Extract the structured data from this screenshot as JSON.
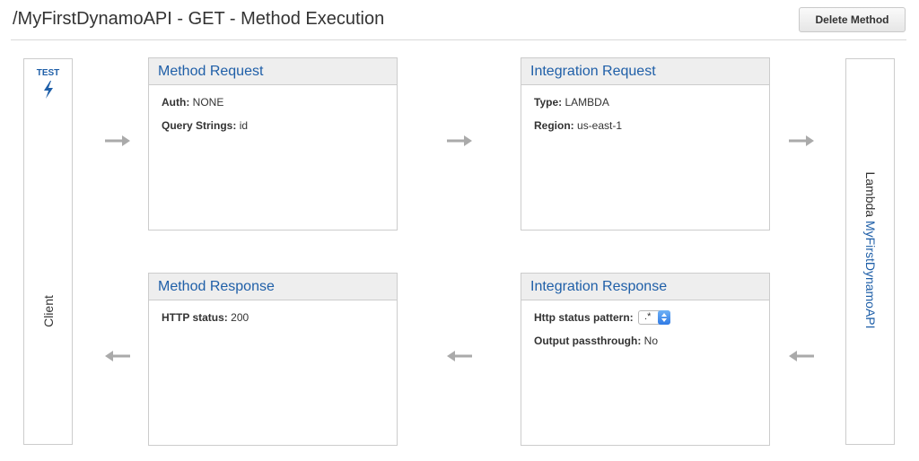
{
  "header": {
    "title": "/MyFirstDynamoAPI - GET - Method Execution",
    "delete_label": "Delete Method"
  },
  "client": {
    "test_label": "TEST",
    "test_icon": "lightning-bolt-icon",
    "label": "Client"
  },
  "lambda": {
    "prefix": "Lambda",
    "function_name": "MyFirstDynamoAPI"
  },
  "method_request": {
    "title": "Method Request",
    "rows": [
      {
        "key": "Auth:",
        "value": "NONE"
      },
      {
        "key": "Query Strings:",
        "value": "id"
      }
    ]
  },
  "integration_request": {
    "title": "Integration Request",
    "rows": [
      {
        "key": "Type:",
        "value": "LAMBDA"
      },
      {
        "key": "Region:",
        "value": "us-east-1"
      }
    ]
  },
  "method_response": {
    "title": "Method Response",
    "rows": [
      {
        "key": "HTTP status:",
        "value": "200"
      }
    ]
  },
  "integration_response": {
    "title": "Integration Response",
    "status_pattern_key": "Http status pattern:",
    "status_pattern_value": ".*",
    "passthrough_key": "Output passthrough:",
    "passthrough_value": "No"
  },
  "colors": {
    "link_blue": "#1f5fa8",
    "box_header_bg": "#eeeeee",
    "border": "#cccccc",
    "arrow_gray": "#aaaaaa"
  }
}
